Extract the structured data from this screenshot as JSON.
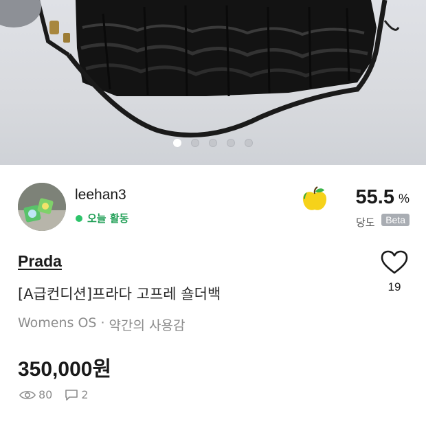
{
  "gallery": {
    "image_alt": "Black ruched Prada shoulder bag with long leather strap",
    "page_count": 5,
    "active_index": 0
  },
  "seller": {
    "name": "leehan3",
    "status": "오늘 활동",
    "status_color": "#2dc46a",
    "temperature_value": "55.5",
    "temperature_unit": "%",
    "temperature_label": "당도",
    "temperature_badge": "Beta"
  },
  "product": {
    "brand": "Prada",
    "title": "[A급컨디션]프라다 고프레 숄더백",
    "category": "Womens OS",
    "separator": "·",
    "condition": "약간의 사용감",
    "price": "350,000원",
    "views": "80",
    "comments": "2",
    "likes": "19"
  },
  "icons": {
    "temperature": "apple-icon",
    "like": "heart-outline-icon",
    "views": "eye-icon",
    "comments": "chat-icon"
  }
}
